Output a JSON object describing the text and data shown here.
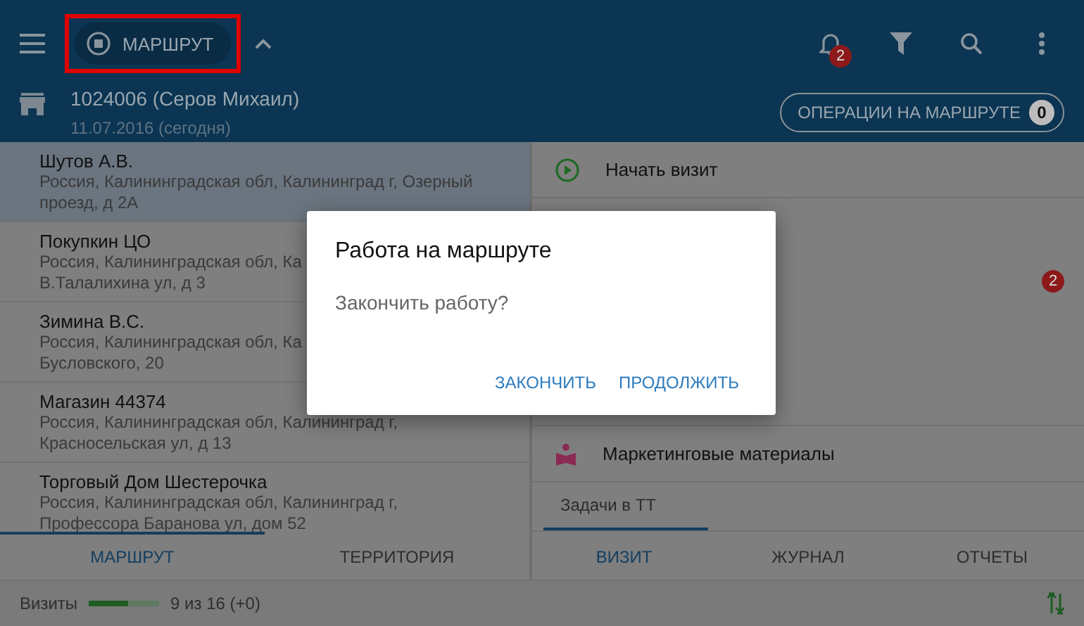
{
  "app_bar": {
    "route_chip": {
      "label": "МАРШРУТ",
      "highlighted": true
    },
    "notifications_badge": "2",
    "agent": "1024006 (Серов Михаил)",
    "date": "11.07.2016 (сегодня)",
    "operations_button": {
      "label": "ОПЕРАЦИИ НА МАРШРУТЕ",
      "count": "0"
    }
  },
  "outlets": [
    {
      "name": "Шутов А.В.",
      "address": "Россия, Калининградская обл, Калининград г, Озерный проезд, д 2А",
      "selected": true
    },
    {
      "name": "Покупкин ЦО",
      "address": "Россия, Калининградская обл, Ка",
      "address_2": "В.Талалихина ул, д 3",
      "selected": false
    },
    {
      "name": "Зимина В.С.",
      "address": "Россия, Калининградская обл, Ка",
      "address_2": "Бусловского, 20",
      "selected": false
    },
    {
      "name": "Магазин 44374",
      "address": "Россия, Калининградская обл, Калининград г, Красносельская ул, д 13",
      "selected": false
    },
    {
      "name": "Торговый Дом Шестерочка",
      "address": "Россия, Калининградская обл, Калининград г, Профессора Баранова ул, дом 52",
      "selected": false
    }
  ],
  "left_tabs": [
    {
      "label": "МАРШРУТ",
      "selected": true
    },
    {
      "label": "ТЕРРИТОРИЯ",
      "selected": false
    }
  ],
  "actions": [
    {
      "kind": "start",
      "label": "Начать визит"
    },
    {
      "kind": "badge",
      "badge": "2"
    },
    {
      "kind": "marketing",
      "label": "Маркетинговые материалы"
    }
  ],
  "sub_tabs": [
    {
      "label": "Задачи в ТТ",
      "selected": true
    }
  ],
  "right_tabs": [
    {
      "label": "ВИЗИТ",
      "selected": true
    },
    {
      "label": "ЖУРНАЛ",
      "selected": false
    },
    {
      "label": "ОТЧЕТЫ",
      "selected": false
    }
  ],
  "status_bar": {
    "label": "Визиты",
    "level": 0.56,
    "reading": "9 из 16 (+0)"
  },
  "dialog": {
    "title": "Работа на маршруте",
    "message": "Закончить работу?",
    "buttons": [
      "ЗАКОНЧИТЬ",
      "ПРОДОЛЖИТЬ"
    ]
  }
}
